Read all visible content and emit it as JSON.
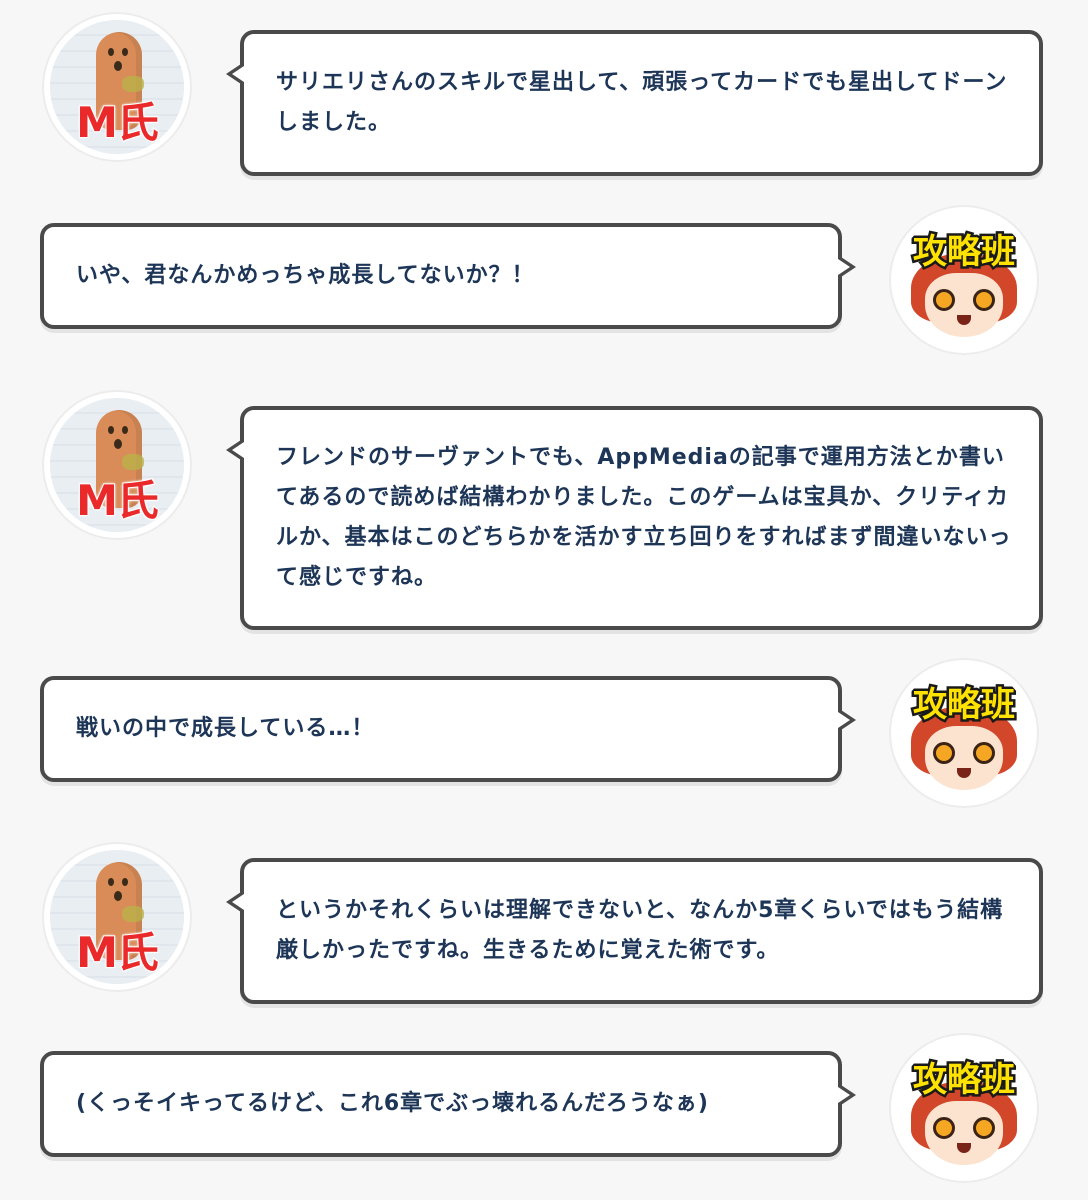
{
  "speakers": {
    "m": {
      "label": "M氏",
      "label_color": "#ea2a2a"
    },
    "team": {
      "label": "攻略班",
      "label_color": "#ffe200"
    }
  },
  "messages": [
    {
      "speaker": "m",
      "text": "サリエリさんのスキルで星出して、頑張ってカードでも星出してドーンしました。"
    },
    {
      "speaker": "team",
      "text": "いや、君なんかめっちゃ成長してないか？！"
    },
    {
      "speaker": "m",
      "text": "フレンドのサーヴァントでも、AppMediaの記事で運用方法とか書いてあるので読めば結構わかりました。このゲームは宝具か、クリティカルか、基本はこのどちらかを活かす立ち回りをすればまず間違いないって感じですね。"
    },
    {
      "speaker": "team",
      "text": "戦いの中で成長している…！"
    },
    {
      "speaker": "m",
      "text": "というかそれくらいは理解できないと、なんか5章くらいではもう結構厳しかったですね。生きるために覚えた術です。"
    },
    {
      "speaker": "team",
      "text": "(くっそイキってるけど、これ6章でぶっ壊れるんだろうなぁ)"
    }
  ],
  "colors": {
    "text": "#1d3557",
    "bubble_border": "#4a4a4a",
    "background": "#f7f7f7"
  }
}
